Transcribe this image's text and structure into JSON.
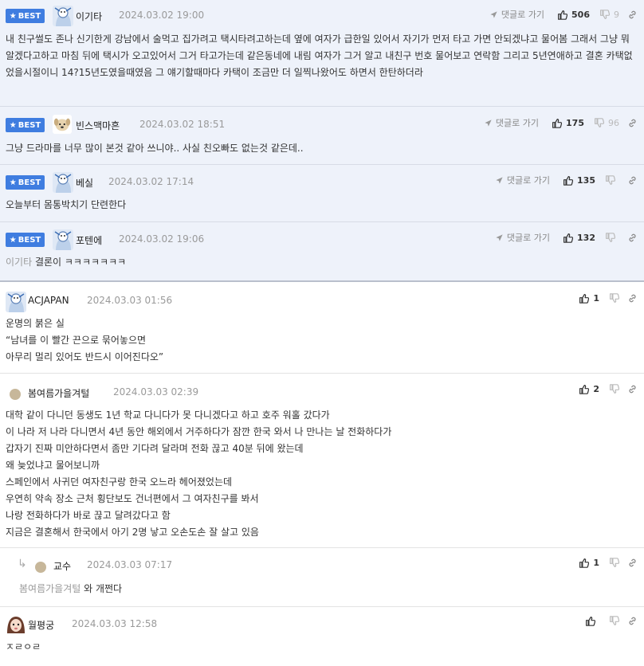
{
  "best_label": "BEST",
  "goto_label": "댓글로 가기",
  "comments": [
    {
      "nick": "이기타",
      "date": "2024.03.02 19:00",
      "likes": "506",
      "dislikes": "9",
      "text": "내 친구썰도 존나 신기한게 강남에서 술먹고 집가려고 택시타려고하는데 옆에 여자가 급한일 있어서 자기가 먼저 타고 가면 안되겠냐고 물어봄 그래서 그냥 뭐 알겠다고하고 마침 뒤에 택시가 오고있어서 그거 타고가는데 같은동네에 내림 여자가 그거 알고 내친구 번호 물어보고 연락함 그리고 5년연애하고 결혼 카택없었을시절이니 14?15년도였을때였음 그 얘기할때마다 카택이 조금만 더 일찍나왔어도 하면서 한탄하더라"
    },
    {
      "nick": "빈스맥마흔",
      "date": "2024.03.02 18:51",
      "likes": "175",
      "dislikes": "96",
      "text": "그냥 드라마를 너무 많이 본것 같아 쓰니야.. 사실 친오빠도 없는것 같은데.."
    },
    {
      "nick": "베실",
      "date": "2024.03.02 17:14",
      "likes": "135",
      "dislikes": "",
      "text": "오늘부터 몸통박치기 단련한다"
    },
    {
      "nick": "포텐에",
      "date": "2024.03.02 19:06",
      "likes": "132",
      "dislikes": "",
      "mention": "이기타",
      "text": "결론이 ㅋㅋㅋㅋㅋㅋㅋ"
    },
    {
      "nick": "ACJAPAN",
      "date": "2024.03.03 01:56",
      "likes": "1",
      "lines": [
        "운명의 붉은 실",
        "“남녀를 이 빨간 끈으로 묶어놓으면",
        "아무리 멀리 있어도 반드시 이어진다오”"
      ]
    },
    {
      "nick": "봄여름가을겨털",
      "date": "2024.03.03 02:39",
      "likes": "2",
      "lines": [
        "대학 같이 다니던 동생도 1년 학교 다니다가 못 다니겠다고 하고 호주 워홀 갔다가",
        "이 나라 저 나라 다니면서 4년 동안 해외에서 거주하다가 잠깐 한국 와서 나 만나는 날 전화하다가",
        "갑자기 진짜 미안하다면서 좀만 기다려 달라며 전화 끊고 40분 뒤에 왔는데",
        "왜 늦었냐고 물어보니까",
        "스페인에서 사귀던 여자친구랑 한국 오느라 헤어졌었는데",
        "우연히 약속 장소 근처 횡단보도 건너편에서 그 여자친구를 봐서",
        "나랑 전화하다가 바로 끊고 달려갔다고 함",
        "지금은 결혼해서 한국에서 아기 2명 낳고 오손도손 잘 살고 있음"
      ]
    },
    {
      "nick": "교수",
      "date": "2024.03.03 07:17",
      "likes": "1",
      "mention": "봄여름가을겨털",
      "text": "와 개쩐다"
    },
    {
      "nick": "월평궁",
      "date": "2024.03.03 12:58",
      "likes": "",
      "text": "ㅈㄹㅇㄹ"
    }
  ],
  "icons": {
    "like": "thumbs-up-icon",
    "dislike": "thumbs-down-icon",
    "link": "link-icon",
    "goto": "arrow-icon",
    "star": "star-icon",
    "reply": "reply-arrow-icon"
  },
  "colors": {
    "best_bg": "#eef2fa",
    "best_badge": "#3f7de0",
    "date": "#9a9a9a"
  }
}
